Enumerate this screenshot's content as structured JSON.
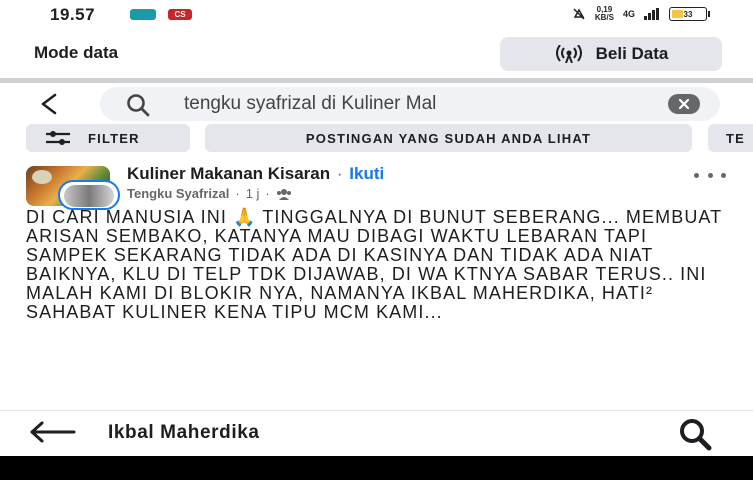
{
  "status_bar": {
    "time": "19.57",
    "app_icon_2": "CS",
    "speed_value": "0,19",
    "speed_unit": "KB/S",
    "network": "4G",
    "battery_percent": "33",
    "battery_level": 0.33
  },
  "data_bar": {
    "title": "Mode data",
    "buy_label": "Beli Data"
  },
  "search": {
    "query": "tengku syafrizal di Kuliner Mal"
  },
  "chips": {
    "filter_label": "FILTER",
    "seen_label": "POSTINGAN YANG SUDAH ANDA LIHAT",
    "cut_label": "TE"
  },
  "post": {
    "group_name": "Kuliner Makanan Kisaran",
    "separator": "·",
    "follow_label": "Ikuti",
    "author": "Tengku Syafrizal",
    "time": "1 j",
    "text": "DI CARI MANUSIA INI 🙏 TINGGALNYA DI BUNUT SEBERANG... MEMBUAT ARISAN SEMBAKO, KATANYA MAU DIBAGI WAKTU LEBARAN TAPI SAMPEK SEKARANG TIDAK ADA DI KASINYA DAN TIDAK ADA NIAT BAIKNYA, KLU DI TELP TDK DIJAWAB, DI WA KTNYA SABAR TERUS.. INI MALAH KAMI DI BLOKIR NYA, NAMANYA IKBAL MAHERDIKA, HATI² SAHABAT KULINER KENA TIPU MCM KAMI..."
  },
  "bottom_header": {
    "title": "Ikbal Maherdika"
  },
  "colors": {
    "accent": "#1877f2",
    "chip_bg": "#e4e6eb",
    "search_bg": "#f0f2f5",
    "battery": "#f4c542"
  }
}
